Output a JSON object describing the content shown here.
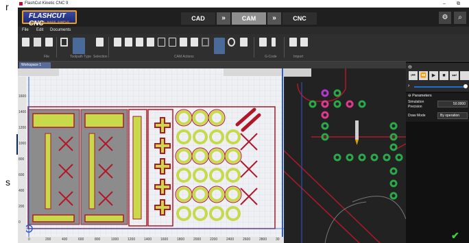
{
  "side_text": {
    "top": "r",
    "bottom": "s"
  },
  "window": {
    "title": "FlashCut Kinetic CNC 9"
  },
  "logo": {
    "title": "FLASHCUT CNC",
    "subtitle": "CONTROL MADE SIMPLE"
  },
  "modes": [
    "CAD",
    "CAM",
    "CNC"
  ],
  "menu": [
    "File",
    "Edit",
    "Documents"
  ],
  "ribbon_groups": [
    "File",
    "Toolpath Type",
    "Selection",
    "CAM Actions",
    "G-Code",
    "Import"
  ],
  "document_tab": "Workspace 1",
  "y_ruler": [
    "1600",
    "1400",
    "1200",
    "1000",
    "800",
    "600",
    "400",
    "200",
    "0"
  ],
  "x_ruler": [
    "0",
    "200",
    "400",
    "600",
    "800",
    "1000",
    "1200",
    "1400",
    "1600",
    "1800",
    "2000",
    "2200",
    "2400",
    "2600",
    "2800",
    "30"
  ],
  "panel": {
    "section": "Parameters",
    "simulation_precision_label": "Simulation Precision",
    "simulation_precision_value": "50.0000",
    "draw_mode_label": "Draw Mode",
    "draw_mode_value": "By operation"
  },
  "colors": {
    "accent": "#f0a020",
    "part_fill": "#c8d94a",
    "part_outline": "#b0182a",
    "toolpath": "#9a1c2e"
  }
}
